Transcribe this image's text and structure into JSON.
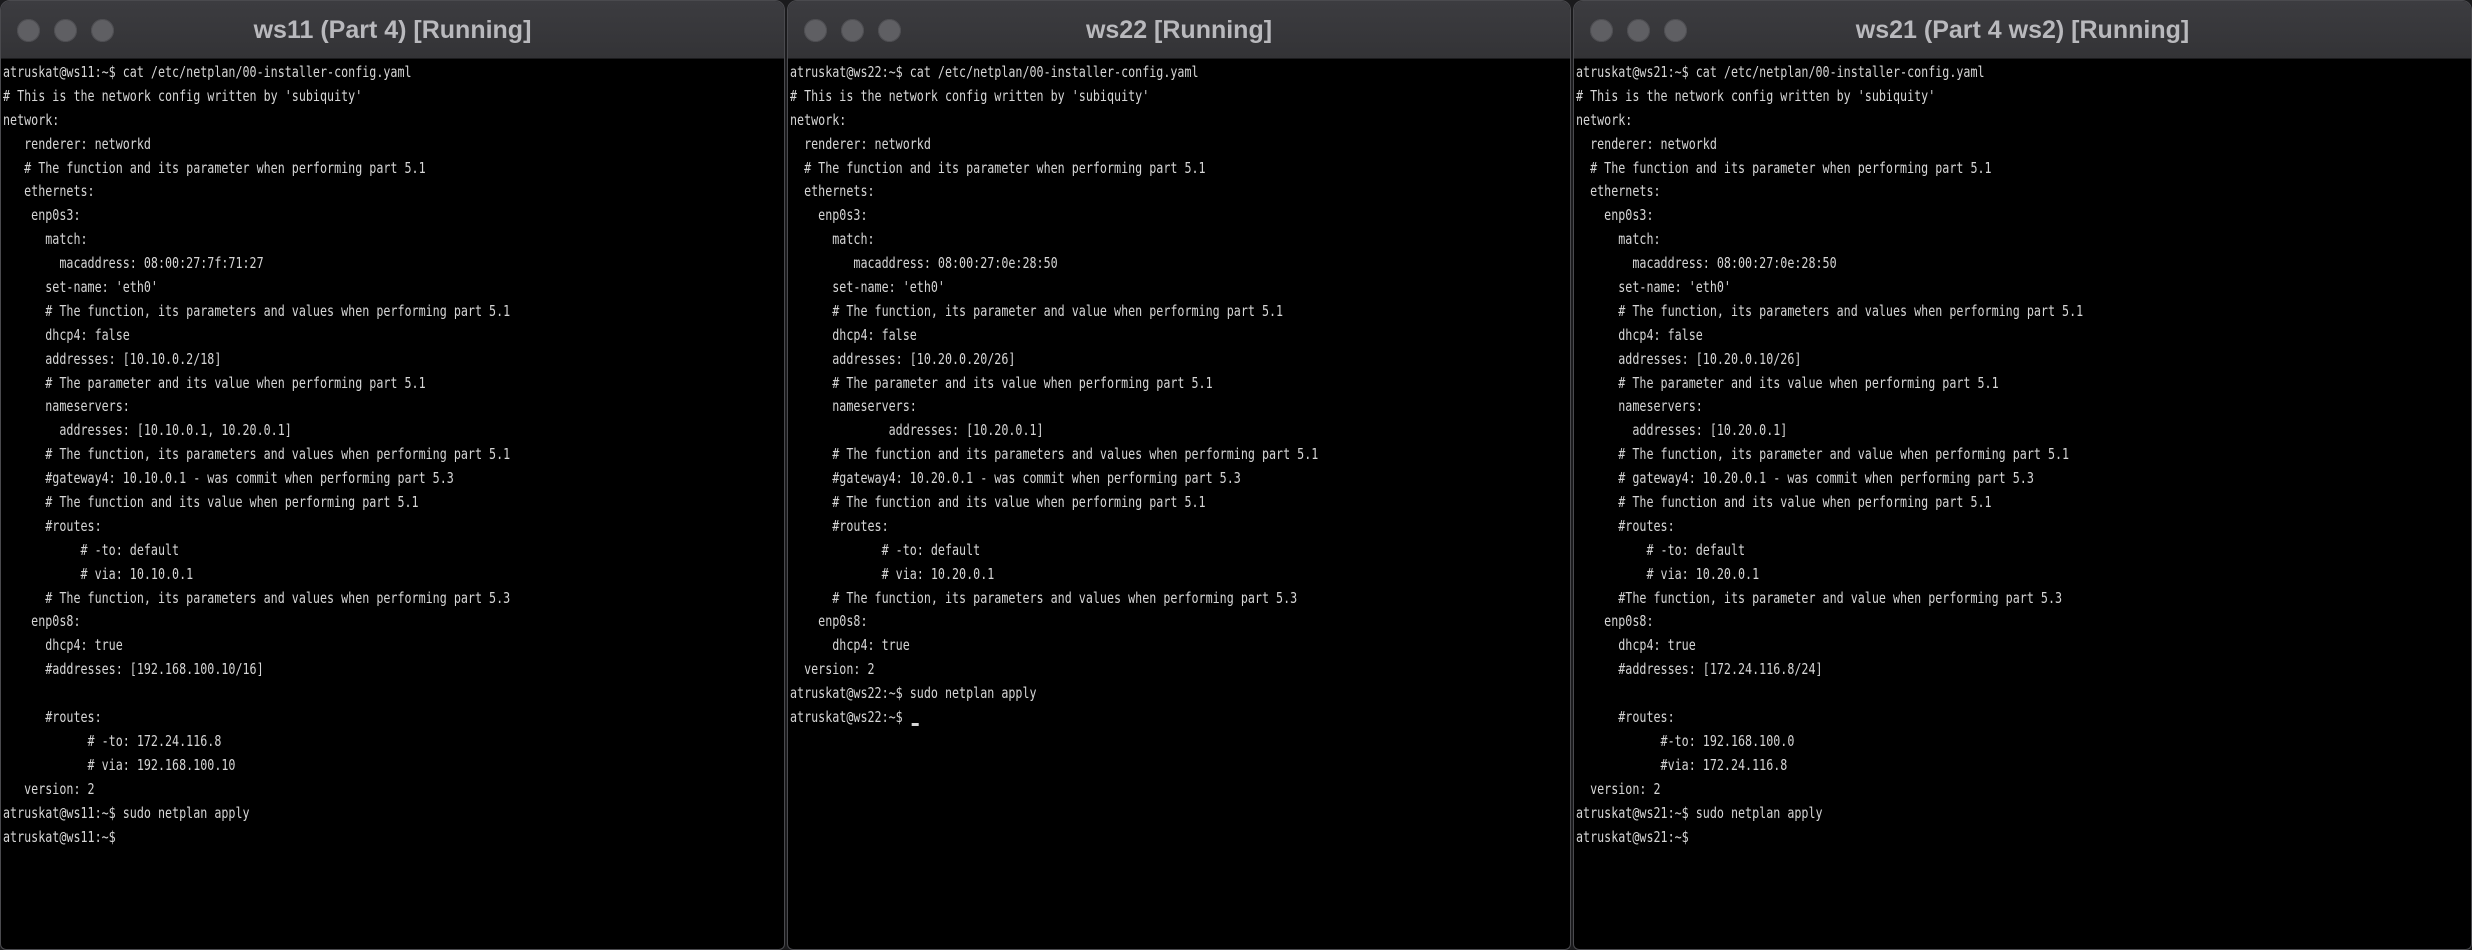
{
  "windows": [
    {
      "id": "ws11",
      "title": "ws11 (Part 4) [Running]",
      "lines": [
        "atruskat@ws11:~$ cat /etc/netplan/00-installer-config.yaml",
        "# This is the network config written by 'subiquity'",
        "network:",
        "   renderer: networkd",
        "   # The function and its parameter when performing part 5.1",
        "   ethernets:",
        "    enp0s3:",
        "      match:",
        "        macaddress: 08:00:27:7f:71:27",
        "      set-name: 'eth0'",
        "      # The function, its parameters and values when performing part 5.1",
        "      dhcp4: false",
        "      addresses: [10.10.0.2/18]",
        "      # The parameter and its value when performing part 5.1",
        "      nameservers:",
        "        addresses: [10.10.0.1, 10.20.0.1]",
        "      # The function, its parameters and values when performing part 5.1",
        "      #gateway4: 10.10.0.1 - was commit when performing part 5.3",
        "      # The function and its value when performing part 5.1",
        "      #routes:",
        "           # -to: default",
        "           # via: 10.10.0.1",
        "      # The function, its parameters and values when performing part 5.3",
        "    enp0s8:",
        "      dhcp4: true",
        "      #addresses: [192.168.100.10/16]",
        "",
        "      #routes:",
        "            # -to: 172.24.116.8",
        "            # via: 192.168.100.10",
        "   version: 2",
        "atruskat@ws11:~$ sudo netplan apply",
        "atruskat@ws11:~$"
      ],
      "show_cursor": false
    },
    {
      "id": "ws22",
      "title": "ws22 [Running]",
      "lines": [
        "atruskat@ws22:~$ cat /etc/netplan/00-installer-config.yaml",
        "# This is the network config written by 'subiquity'",
        "network:",
        "  renderer: networkd",
        "  # The function and its parameter when performing part 5.1",
        "  ethernets:",
        "    enp0s3:",
        "      match:",
        "         macaddress: 08:00:27:0e:28:50",
        "      set-name: 'eth0'",
        "      # The function, its parameter and value when performing part 5.1",
        "      dhcp4: false",
        "      addresses: [10.20.0.20/26]",
        "      # The parameter and its value when performing part 5.1",
        "      nameservers:",
        "              addresses: [10.20.0.1]",
        "      # The function and its parameters and values when performing part 5.1",
        "      #gateway4: 10.20.0.1 - was commit when performing part 5.3",
        "      # The function and its value when performing part 5.1",
        "      #routes:",
        "             # -to: default",
        "             # via: 10.20.0.1",
        "      # The function, its parameters and values when performing part 5.3",
        "    enp0s8:",
        "      dhcp4: true",
        "  version: 2",
        "atruskat@ws22:~$ sudo netplan apply",
        "atruskat@ws22:~$ "
      ],
      "show_cursor": true
    },
    {
      "id": "ws21",
      "title": "ws21 (Part 4 ws2) [Running]",
      "lines": [
        "atruskat@ws21:~$ cat /etc/netplan/00-installer-config.yaml",
        "# This is the network config written by 'subiquity'",
        "network:",
        "  renderer: networkd",
        "  # The function and its parameter when performing part 5.1",
        "  ethernets:",
        "    enp0s3:",
        "      match:",
        "        macaddress: 08:00:27:0e:28:50",
        "      set-name: 'eth0'",
        "      # The function, its parameters and values when performing part 5.1",
        "      dhcp4: false",
        "      addresses: [10.20.0.10/26]",
        "      # The parameter and its value when performing part 5.1",
        "      nameservers:",
        "        addresses: [10.20.0.1]",
        "      # The function, its parameter and value when performing part 5.1",
        "      # gateway4: 10.20.0.1 - was commit when performing part 5.3",
        "      # The function and its value when performing part 5.1",
        "      #routes:",
        "          # -to: default",
        "          # via: 10.20.0.1",
        "      #The function, its parameter and value when performing part 5.3",
        "    enp0s8:",
        "      dhcp4: true",
        "      #addresses: [172.24.116.8/24]",
        "",
        "      #routes:",
        "            #-to: 192.168.100.0",
        "            #via: 172.24.116.8",
        "  version: 2",
        "atruskat@ws21:~$ sudo netplan apply",
        "atruskat@ws21:~$"
      ],
      "show_cursor": false
    }
  ]
}
